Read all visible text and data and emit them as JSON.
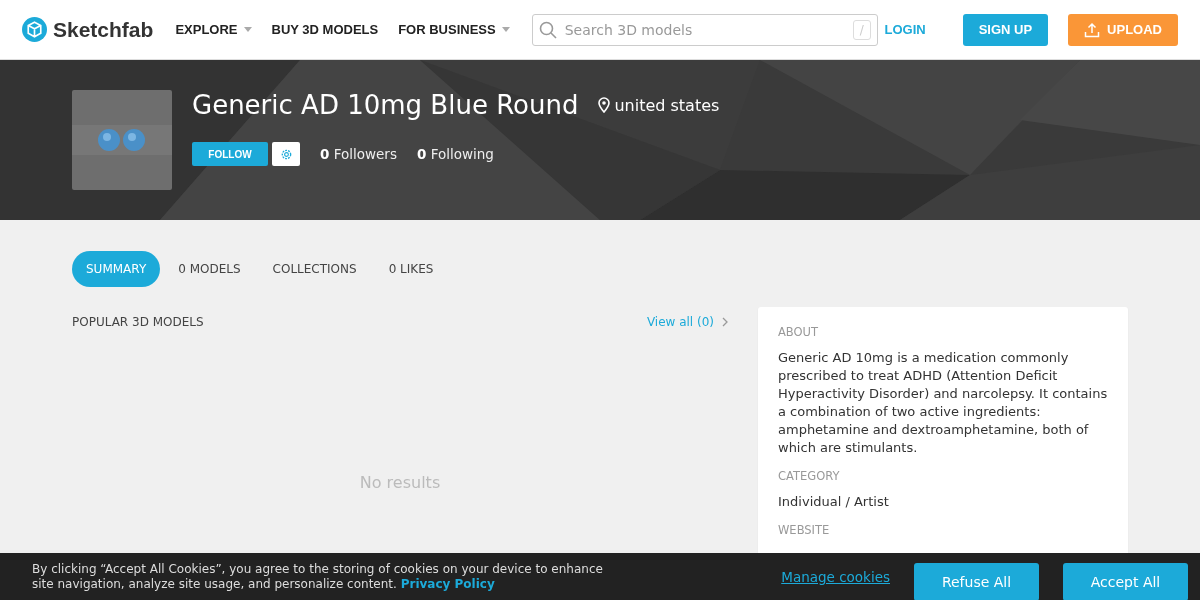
{
  "nav": {
    "logo": "Sketchfab",
    "items": [
      {
        "label": "EXPLORE",
        "dropdown": true
      },
      {
        "label": "BUY 3D MODELS",
        "dropdown": false
      },
      {
        "label": "FOR BUSINESS",
        "dropdown": true
      }
    ],
    "search": {
      "placeholder": "Search 3D models",
      "shortcut": "/"
    },
    "login": "LOGIN",
    "signup": "SIGN UP",
    "upload": "UPLOAD"
  },
  "profile": {
    "name": "Generic AD 10mg Blue Round",
    "location": "united states",
    "follow": "FOLLOW",
    "followers": {
      "count": "0",
      "label": "Followers"
    },
    "following": {
      "count": "0",
      "label": "Following"
    }
  },
  "tabs": [
    {
      "label": "SUMMARY",
      "selected": true
    },
    {
      "label": "0 MODELS",
      "selected": false
    },
    {
      "label": "COLLECTIONS",
      "selected": false
    },
    {
      "label": "0 LIKES",
      "selected": false
    }
  ],
  "popular": {
    "title": "POPULAR 3D MODELS",
    "view_all": "View all (0)",
    "empty": "No results"
  },
  "about": {
    "sections": [
      {
        "heading": "ABOUT",
        "text": "Generic AD 10mg is a medication commonly prescribed to treat ADHD (Attention Deficit Hyperactivity Disorder) and narcolepsy. It contains a combination of two active ingredients: amphetamine and dextroamphetamine, both of which are stimulants."
      },
      {
        "heading": "CATEGORY",
        "text": "Individual / Artist"
      },
      {
        "heading": "WEBSITE"
      }
    ]
  },
  "cookies": {
    "text": "By clicking “Accept All Cookies”, you agree to the storing of cookies on your device to enhance site navigation, analyze site usage, and personalize content.",
    "policy": "Privacy Policy",
    "manage": "Manage cookies",
    "refuse": "Refuse All",
    "accept": "Accept All"
  }
}
